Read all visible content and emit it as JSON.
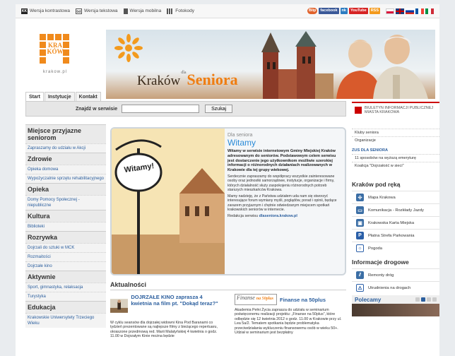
{
  "topbar": {
    "links": [
      "Wersja kontrastowa",
      "Wersja tekstowa",
      "Wersja mobilna",
      "Fotokody"
    ],
    "social": [
      "Blip",
      "facebook",
      "nk",
      "YouTube",
      "RSS"
    ]
  },
  "logo": {
    "text_1": "KRA",
    "text_2": "KÓW",
    "url": "krakow.pl"
  },
  "banner": {
    "brand_1": "Kraków",
    "brand_dla": "dla",
    "brand_2": "Seniora"
  },
  "tabs": [
    "Start",
    "Instytucje",
    "Kontakt"
  ],
  "search": {
    "label": "Znajdź w serwisie",
    "value": "",
    "button": "Szukaj"
  },
  "bip": {
    "line1": "BIULETYN INFORMACJI PUBLICZNEJ",
    "line2": "MIASTA KRAKOWA"
  },
  "sidebar": [
    {
      "cat": "Miejsce przyjazne seniorom",
      "items": [
        "Zapraszamy do udziału w Akcji"
      ]
    },
    {
      "cat": "Zdrowie",
      "items": [
        "Opieka domowa",
        "Wypożyczalnie sprzętu rehabilitacyjnego"
      ]
    },
    {
      "cat": "Opieka",
      "items": [
        "Domy Pomocy Społecznej - niepubliczne"
      ]
    },
    {
      "cat": "Kultura",
      "items": [
        "Biblioteki"
      ]
    },
    {
      "cat": "Rozrywka",
      "items": [
        "Dojrzali do sztuki w MCK",
        "Rozmaitości",
        "Dojrzałe kino"
      ]
    },
    {
      "cat": "Aktywnie",
      "items": [
        "Sport, gimnastyka, relaksacja",
        "Turystyka"
      ]
    },
    {
      "cat": "Edukacja",
      "items": [
        "Krakowskie Uniwersytety Trzeciego Wieku"
      ]
    }
  ],
  "welcome": {
    "sign": "Witamy!",
    "kicker": "Dla seniora",
    "title": "Witamy",
    "bold": "Witamy w serwisie internetowym Gminy Miejskiej Kraków adresowanym do seniorów. Podstawowym celem serwisu jest dostarczenie jego użytkownikom możliwie szerokiej informacji o różnorodnych działaniach realizowanych w Krakowie dla tej grupy wiekowej.",
    "body1": "Serdecznie zapraszamy do współpracy wszystkie zainteresowane osoby oraz jednostki samorządowe, instytucje, organizacje i firmy, których działalność służy zaspokojeniu różnorodnych potrzeb starszych mieszkańców Krakowa.",
    "body2": "Mamy nadzieję, że z Państwa udziałem uda nam się stworzyć interesujące forum wymiany myśli, poglądów, porad i opinii, będące zarazem przyjaznym i chętnie odwiedzanym miejscem spotkań krakowskich seniorów w internecie.",
    "link_label": "Redakcja serwisu",
    "link": "dlaseniora.krakow.pl"
  },
  "news": {
    "heading": "Aktualności",
    "items": [
      {
        "title": "DOJRZAŁE KINO zaprasza 4 kwietnia na film pt. \"Dokąd teraz?\"",
        "body": "W cyklu seansów dla dojrzałej widowni Kina Pod Baranami co tydzień prezentowane są najlepsze filmy z bieżącego repertuaru, okraszone przedmową red. Marii Malatyńskiej 4 kwietnia o godz. 11.00 w Dojrzałym Kinie można będzie"
      },
      {
        "logo": "Finanse",
        "logo_sub": "na 50plus",
        "title": "Finanse na 50plus",
        "body": "Akademia Pełni Życia zaprasza do udziału w seminarium poświęconemu realizacji projektu: „Finanse na 50plus”, które odbędzie się 12 kwietnia 2012 o godz. 11.00 w Krakowie przy ul. Lea 5a/2. Tematem spotkania będzie problematyka przeciwdziałania wykluczeniu finansowemu osób w wieku 50+. Udział w seminarium jest bezpłatny"
      }
    ]
  },
  "right": {
    "list_top": [
      "Kluby seniora",
      "Organizacje"
    ],
    "zus": "ZUS DLA SENIORA",
    "list_zus": [
      "11 sposobów na wyższą emeryturę",
      "Koalicja \"Dojrzałość w sieci\""
    ],
    "krakow_head": "Kraków pod ręką",
    "krakow_items": [
      {
        "label": "Mapa Krakowa",
        "icon": "compass-icon"
      },
      {
        "label": "Komunikacja - Rozkłady Jazdy",
        "icon": "bus-icon"
      },
      {
        "label": "Krakowska Karta Miejska",
        "icon": "card-icon"
      },
      {
        "label": "Płatna Strefa Parkowania",
        "icon": "parking-icon"
      },
      {
        "label": "Pogoda",
        "icon": "sun-icon"
      }
    ],
    "drogi_head": "Informacje drogowe",
    "drogi_items": [
      {
        "label": "Remonty dróg",
        "icon": "roadworks-icon"
      },
      {
        "label": "Utrudnienia na drogach",
        "icon": "warning-icon"
      }
    ],
    "polecamy": "Polecamy"
  },
  "colors": {
    "accent_orange": "#ef7d11",
    "link_blue": "#2c5f9e",
    "title_blue": "#2a8bd8",
    "bip_red": "#cc0000"
  }
}
